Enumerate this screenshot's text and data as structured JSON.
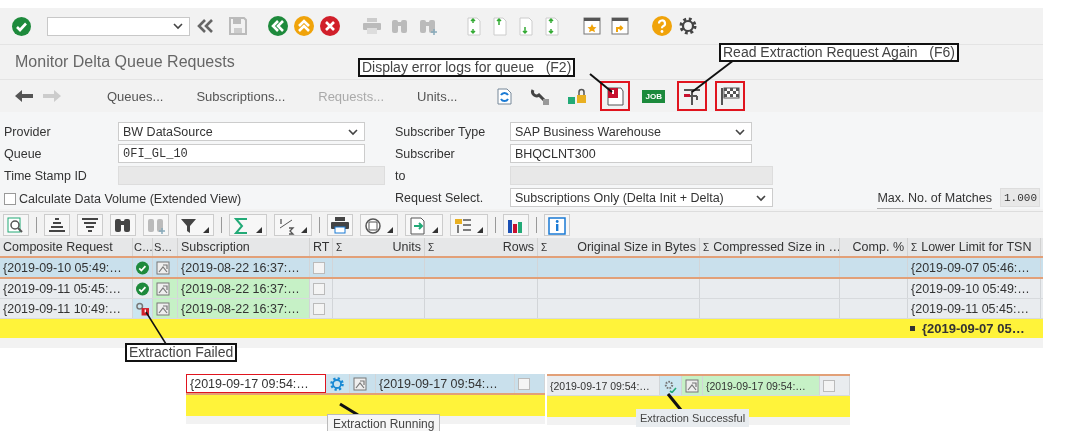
{
  "title": "Monitor Delta Queue Requests",
  "nav_buttons": [
    {
      "label": "Queues...",
      "disabled": false
    },
    {
      "label": "Subscriptions...",
      "disabled": false
    },
    {
      "label": "Requests...",
      "disabled": true
    },
    {
      "label": "Units...",
      "disabled": false
    }
  ],
  "app_icons": [
    {
      "highlighted": false
    },
    {
      "highlighted": false
    },
    {
      "highlighted": false
    },
    {
      "highlighted": true
    },
    {
      "label": "JOB",
      "highlighted": false
    },
    {
      "highlighted": true
    },
    {
      "highlighted": true
    }
  ],
  "selection": {
    "fields": [
      {
        "label": "Provider",
        "value": "BW DataSource",
        "kind": "dropdown"
      },
      {
        "label": "Subscriber Type",
        "value": "SAP Business Warehouse",
        "kind": "dropdown"
      },
      {
        "label": "Queue",
        "value": "0FI_GL_10",
        "kind": "input"
      },
      {
        "label": "Subscriber",
        "value": "BHQCLNT300",
        "kind": "input"
      },
      {
        "label": "Time Stamp ID",
        "kind": "readonly"
      },
      {
        "label": "to",
        "kind": "readonly"
      }
    ],
    "checkbox": {
      "label": "Calculate Data Volume (Extended View)",
      "checked": false
    },
    "request_select": {
      "label": "Request Select.",
      "value": "Subscriptions Only (Delta Init + Delta)"
    },
    "max_matches": {
      "label": "Max. No. of Matches",
      "value": "1.000"
    }
  },
  "table": {
    "columns": [
      {
        "label": "Composite Request"
      },
      {
        "label": "C…"
      },
      {
        "label": "S…"
      },
      {
        "label": "Subscription"
      },
      {
        "label": "RT"
      },
      {
        "label": "Units",
        "sum": "Σ"
      },
      {
        "label": "Rows",
        "sum": "Σ"
      },
      {
        "label": "Original Size in Bytes",
        "sum": "Σ"
      },
      {
        "label": "Compressed Size in …",
        "sum": "Σ"
      },
      {
        "label": "Comp. %"
      },
      {
        "label": "Lower Limit for TSN",
        "sum": "Σ"
      }
    ],
    "rows": [
      {
        "composite": "{2019-09-10 05:49:…",
        "kind": "success",
        "subscription": "{2019-08-22 16:37:…",
        "rt": false,
        "lower_limit": "{2019-09-07 05:46:…",
        "selected": true
      },
      {
        "composite": "{2019-09-11 05:45:…",
        "kind": "success",
        "subscription": "{2019-08-22 16:37:…",
        "rt": false,
        "lower_limit": "{2019-09-10 05:49:…",
        "selected": false
      },
      {
        "composite": "{2019-09-11 10:49:…",
        "kind": "failed",
        "subscription": "{2019-08-22 16:37:…",
        "rt": false,
        "lower_limit": "{2019-09-11 05:45:…",
        "selected": false
      }
    ],
    "total": {
      "lower_limit": "{2019-09-07 05…"
    }
  },
  "insets": [
    {
      "kind": "running",
      "note": "Extraction Running",
      "row": {
        "composite": "{2019-09-17 09:54:…",
        "kind": "running",
        "subscription": "{2019-09-17 09:54:…",
        "rt": false,
        "selected": true
      }
    },
    {
      "kind": "successful",
      "note": "Extraction Successful",
      "row": {
        "composite": "{2019-09-17 09:54:…",
        "kind": "success_small",
        "subscription": "{2019-09-17 09:54:…",
        "rt": false,
        "selected": false
      }
    }
  ],
  "callouts": [
    {
      "kind": "error_log",
      "text": "Display error logs for queue   (F2)"
    },
    {
      "kind": "read_again",
      "text": "Read Extraction Request Again   (F6)"
    },
    {
      "kind": "failed",
      "text": "Extraction Failed"
    }
  ]
}
